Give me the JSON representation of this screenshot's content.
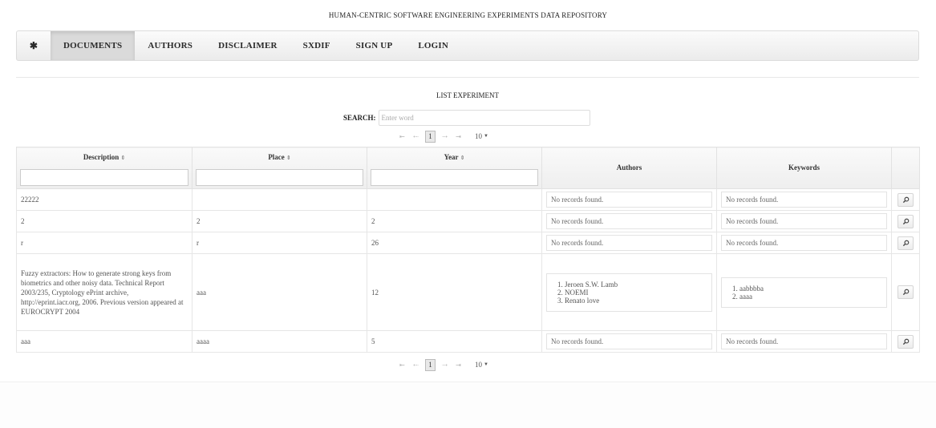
{
  "site": {
    "title": "HUMAN-CENTRIC SOFTWARE ENGINEERING EXPERIMENTS DATA REPOSITORY"
  },
  "nav": {
    "home_glyph": "✱",
    "items": [
      {
        "label": "DOCUMENTS",
        "active": true
      },
      {
        "label": "AUTHORS"
      },
      {
        "label": "DISCLAIMER"
      },
      {
        "label": "SXDIF"
      },
      {
        "label": "SIGN UP"
      },
      {
        "label": "LOGIN"
      }
    ]
  },
  "list": {
    "title": "LIST EXPERIMENT",
    "search_label": "SEARCH:",
    "search_placeholder": "Enter word"
  },
  "paginator": {
    "first": "⇤",
    "prev": "⇠",
    "page": "1",
    "next": "⇢",
    "last": "⇥",
    "rows_per_page": "10"
  },
  "table": {
    "columns": [
      {
        "label": "Description",
        "sortable": true,
        "filter": true
      },
      {
        "label": "Place",
        "sortable": true,
        "filter": true
      },
      {
        "label": "Year",
        "sortable": true,
        "filter": true
      },
      {
        "label": "Authors",
        "sortable": false,
        "filter": false
      },
      {
        "label": "Keywords",
        "sortable": false,
        "filter": false
      },
      {
        "label": "",
        "sortable": false,
        "filter": false
      }
    ],
    "rows": [
      {
        "description": "22222",
        "place": "",
        "year": "",
        "authors": "No records found.",
        "keywords": "No records found."
      },
      {
        "description": "2",
        "place": "2",
        "year": "2",
        "authors": "No records found.",
        "keywords": "No records found."
      },
      {
        "description": "r",
        "place": "r",
        "year": "26",
        "authors": "No records found.",
        "keywords": "No records found."
      },
      {
        "description": "Fuzzy extractors: How to generate strong keys from biometrics and other noisy data. Technical Report 2003/235, Cryptology ePrint archive, http://eprint.iacr.org, 2006. Previous version appeared at EUROCRYPT 2004",
        "place": "aaa",
        "year": "12",
        "authors_list": [
          "Jeroen S.W. Lamb",
          "NOEMI",
          "Renato love"
        ],
        "keywords_list": [
          "aabbbba",
          "aaaa"
        ]
      },
      {
        "description": "aaa",
        "place": "aaaa",
        "year": "5",
        "authors": "No records found.",
        "keywords": "No records found."
      }
    ]
  }
}
